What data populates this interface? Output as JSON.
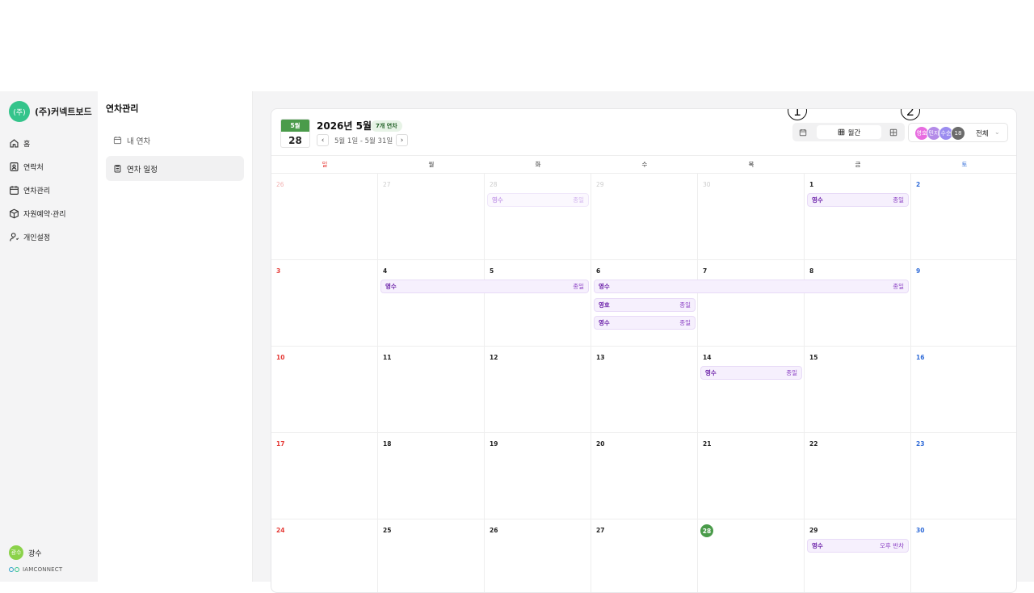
{
  "org": {
    "logo": "(주)",
    "name": "(주)커넥트보드"
  },
  "nav": [
    {
      "label": "홈",
      "icon": "home-icon"
    },
    {
      "label": "연락처",
      "icon": "contacts-icon"
    },
    {
      "label": "연차관리",
      "icon": "calendar-icon"
    },
    {
      "label": "자원예약·관리",
      "icon": "box-icon"
    },
    {
      "label": "개인설정",
      "icon": "user-settings-icon"
    }
  ],
  "user": {
    "avatar": "광수",
    "name": "광수"
  },
  "brand": "IAMCONNECT",
  "subside": {
    "title": "연차관리",
    "items": [
      {
        "label": "내 연차",
        "icon": "calendar-icon"
      },
      {
        "label": "연차 일정",
        "icon": "clipboard-icon"
      }
    ]
  },
  "header": {
    "today_month": "5월",
    "today_day": "28",
    "title": "2026년 5월",
    "count_badge": "7개 연차",
    "range": "5월 1일 - 5월 31일",
    "prev": "‹",
    "next": "›",
    "view_month_label": "월간",
    "people_label": "전체",
    "people": [
      {
        "name": "영호",
        "color": "#e86de0"
      },
      {
        "name": "민지",
        "color": "#b48be8"
      },
      {
        "name": "수순",
        "color": "#9b8cf0"
      },
      {
        "name": "18",
        "color": "#6b6b6b"
      }
    ],
    "caret": "⌄",
    "markers": [
      "1",
      "2"
    ]
  },
  "weekdays": [
    "일",
    "월",
    "화",
    "수",
    "목",
    "금",
    "토"
  ],
  "weeks": [
    [
      "26",
      "27",
      "28",
      "29",
      "30",
      "1",
      "2"
    ],
    [
      "3",
      "4",
      "5",
      "6",
      "7",
      "8",
      "9"
    ],
    [
      "10",
      "11",
      "12",
      "13",
      "14",
      "15",
      "16"
    ],
    [
      "17",
      "18",
      "19",
      "20",
      "21",
      "22",
      "23"
    ],
    [
      "24",
      "25",
      "26",
      "27",
      "28",
      "29",
      "30"
    ]
  ],
  "events": [
    {
      "name": "영수",
      "type": "종일"
    },
    {
      "name": "영수",
      "type": "종일"
    },
    {
      "name": "영수",
      "type": "종일"
    },
    {
      "name": "영수",
      "type": "종일"
    },
    {
      "name": "영호",
      "type": "종일"
    },
    {
      "name": "영수",
      "type": "종일"
    },
    {
      "name": "영수",
      "type": "종일"
    },
    {
      "name": "영수",
      "type": "오후 반차"
    }
  ]
}
